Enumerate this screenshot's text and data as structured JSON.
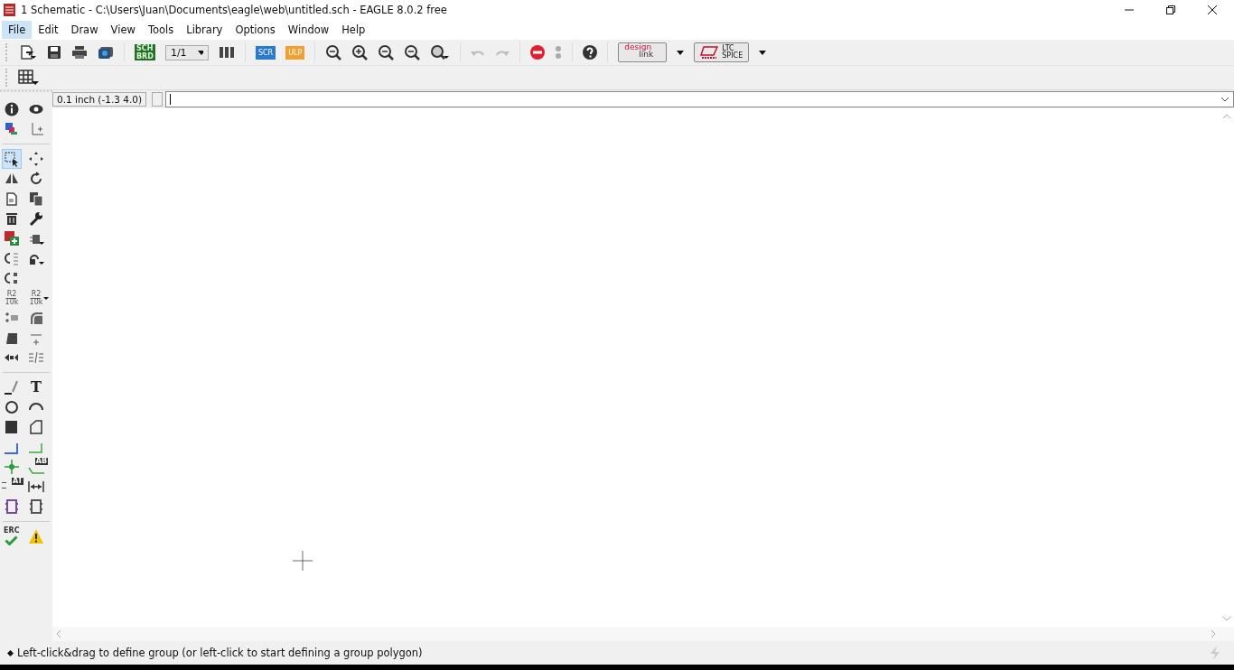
{
  "window": {
    "title": "1 Schematic - C:\\Users\\Juan\\Documents\\eagle\\web\\untitled.sch - EAGLE 8.0.2 free"
  },
  "menu": [
    {
      "label": "File",
      "selected": true
    },
    {
      "label": "Edit",
      "selected": false
    },
    {
      "label": "Draw",
      "selected": false
    },
    {
      "label": "View",
      "selected": false
    },
    {
      "label": "Tools",
      "selected": false
    },
    {
      "label": "Library",
      "selected": false
    },
    {
      "label": "Options",
      "selected": false
    },
    {
      "label": "Window",
      "selected": false
    },
    {
      "label": "Help",
      "selected": false
    }
  ],
  "toolbar": {
    "sch_brd": [
      "SCH",
      "BRD"
    ],
    "sheet_select": "1/1",
    "script": "SCR",
    "ulp": "ULP",
    "design_link": [
      "design",
      "link"
    ],
    "ltspice": [
      "LTC",
      "SPICE"
    ]
  },
  "grid_readout": "0.1 inch (-1.3 4.0)",
  "tool_groups": [
    [
      {
        "selected": false
      },
      {
        "selected": false
      },
      {
        "selected": false
      },
      {
        "selected": false
      }
    ],
    [
      {
        "selected": true
      },
      {
        "selected": false
      },
      {
        "selected": false
      },
      {
        "selected": false
      },
      {
        "selected": false
      },
      {
        "selected": false
      },
      {
        "selected": false
      },
      {
        "selected": false
      },
      {
        "selected": false
      },
      {
        "selected": false
      },
      {
        "selected": false
      },
      {
        "selected": false
      },
      {
        "selected": false
      },
      {
        "selected": false,
        "text": [
          "R2",
          "10k"
        ]
      },
      {
        "selected": false,
        "text": [
          "R2",
          "10k"
        ]
      },
      {
        "selected": false
      },
      {
        "selected": false
      },
      {
        "selected": false
      },
      {
        "selected": false
      },
      {
        "selected": false
      },
      {
        "selected": false
      }
    ],
    [
      {
        "selected": false
      },
      {
        "selected": false,
        "text": [
          "T"
        ]
      },
      {
        "selected": false
      },
      {
        "selected": false
      },
      {
        "selected": false
      },
      {
        "selected": false
      },
      {
        "selected": false
      },
      {
        "selected": false
      },
      {
        "selected": false
      },
      {
        "selected": false,
        "text": [
          "AB"
        ]
      },
      {
        "selected": false,
        "text": [
          "AT"
        ]
      },
      {
        "selected": false
      },
      {
        "selected": false
      },
      {
        "selected": false
      }
    ],
    [
      {
        "selected": false,
        "text": [
          "ERC"
        ]
      },
      {
        "selected": false
      }
    ]
  ],
  "status_bar": {
    "message": "Left-click&drag to define group (or left-click to start defining a group polygon)"
  }
}
